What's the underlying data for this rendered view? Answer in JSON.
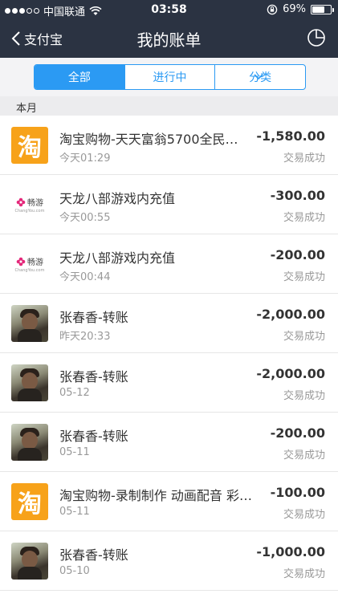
{
  "status_bar": {
    "carrier": "中国联通",
    "time": "03:58",
    "battery": "69%",
    "battery_level": 0.69
  },
  "nav": {
    "back_label": "支付宝",
    "title": "我的账单"
  },
  "tabs": [
    {
      "label": "全部",
      "active": true
    },
    {
      "label": "进行中",
      "active": false
    },
    {
      "label": "分类",
      "active": false
    }
  ],
  "section": {
    "label": "本月"
  },
  "transactions": [
    {
      "icon": "taobao",
      "name": "淘宝购物-天天富翁5700全民…",
      "time": "今天01:29",
      "amount": "-1,580.00",
      "status": "交易成功"
    },
    {
      "icon": "changyou",
      "name": "天龙八部游戏内充值",
      "time": "今天00:55",
      "amount": "-300.00",
      "status": "交易成功"
    },
    {
      "icon": "changyou",
      "name": "天龙八部游戏内充值",
      "time": "今天00:44",
      "amount": "-200.00",
      "status": "交易成功"
    },
    {
      "icon": "photo",
      "name": "张春香-转账",
      "time": "昨天20:33",
      "amount": "-2,000.00",
      "status": "交易成功"
    },
    {
      "icon": "photo",
      "name": "张春香-转账",
      "time": "05-12",
      "amount": "-2,000.00",
      "status": "交易成功"
    },
    {
      "icon": "photo",
      "name": "张春香-转账",
      "time": "05-11",
      "amount": "-200.00",
      "status": "交易成功"
    },
    {
      "icon": "taobao",
      "name": "淘宝购物-录制制作 动画配音 彩…",
      "time": "05-11",
      "amount": "-100.00",
      "status": "交易成功"
    },
    {
      "icon": "photo",
      "name": "张春香-转账",
      "time": "05-10",
      "amount": "-1,000.00",
      "status": "交易成功"
    }
  ],
  "logos": {
    "taobao_char": "淘",
    "changyou_text": "畅游",
    "changyou_small": "ChangYou.com"
  },
  "colors": {
    "header_bg": "#2b3342",
    "accent": "#2b9af3",
    "taobao_orange": "#f7a21a"
  }
}
